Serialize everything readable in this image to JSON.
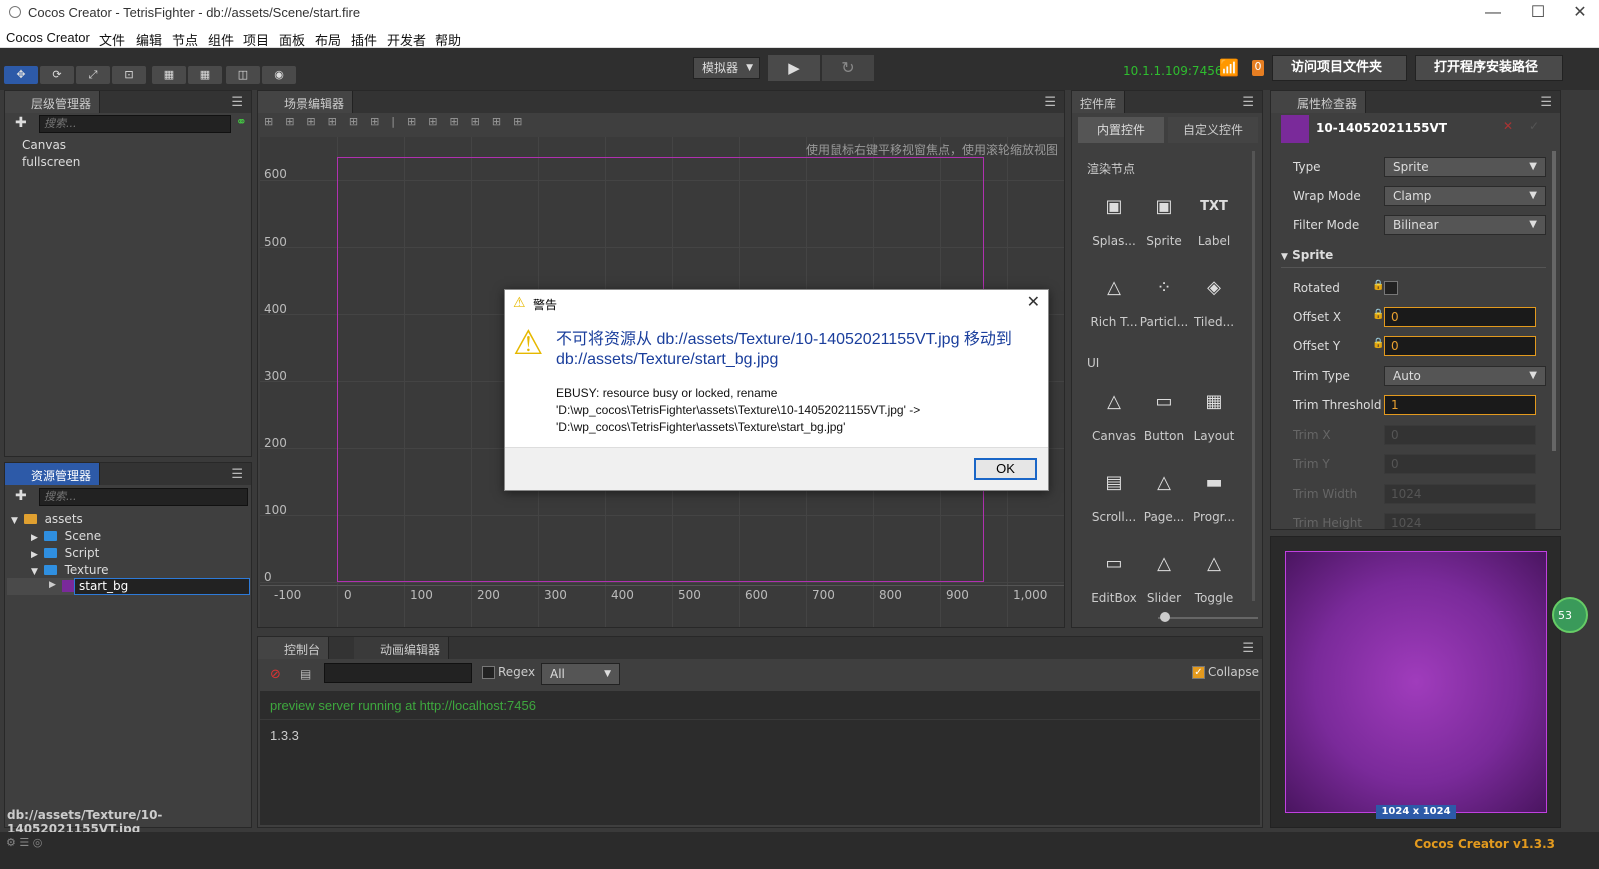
{
  "window": {
    "title": "Cocos Creator - TetrisFighter - db://assets/Scene/start.fire",
    "minimize": "—",
    "maximize": "☐",
    "close": "✕"
  },
  "menu": [
    "Cocos Creator",
    "文件",
    "编辑",
    "节点",
    "组件",
    "项目",
    "面板",
    "布局",
    "插件",
    "开发者",
    "帮助"
  ],
  "toolbar": {
    "platform_select": "模拟器",
    "play_icon": "▶",
    "refresh_icon": "↻",
    "ip": "10.1.1.109:7456",
    "badge": "0",
    "open_project_btn": "访问项目文件夹",
    "open_install_btn": "打开程序安装路径"
  },
  "hierarchy": {
    "title": "层级管理器",
    "search_placeholder": "搜索...",
    "items": [
      "Canvas",
      "fullscreen"
    ]
  },
  "assets": {
    "title": "资源管理器",
    "search_placeholder": "搜索...",
    "root": "assets",
    "children": [
      "Scene",
      "Script",
      "Texture"
    ],
    "editing_name": "start_bg",
    "status_path": "db://assets/Texture/10-14052021155VT.jpg"
  },
  "scene": {
    "title": "场景编辑器",
    "hint": "使用鼠标右键平移视窗焦点，使用滚轮缩放视图",
    "y_ticks": [
      "600",
      "500",
      "400",
      "300",
      "200",
      "100",
      "0"
    ],
    "x_ticks": [
      "-100",
      "0",
      "100",
      "200",
      "300",
      "400",
      "500",
      "600",
      "700",
      "800",
      "900",
      "1,000"
    ]
  },
  "components": {
    "title": "控件库",
    "tab_builtin": "内置控件",
    "tab_custom": "自定义控件",
    "section_render": "渲染节点",
    "section_ui": "UI",
    "render_items": [
      "Splas...",
      "Sprite",
      "Label",
      "Rich T...",
      "Particl...",
      "Tiled..."
    ],
    "ui_items": [
      "Canvas",
      "Button",
      "Layout",
      "Scroll...",
      "Page...",
      "Progr...",
      "EditBox",
      "Slider",
      "Toggle"
    ]
  },
  "inspector": {
    "title": "属性检查器",
    "asset_name": "10-14052021155VT",
    "type_label": "Type",
    "type_value": "Sprite",
    "wrap_label": "Wrap Mode",
    "wrap_value": "Clamp",
    "filter_label": "Filter Mode",
    "filter_value": "Bilinear",
    "sprite_section": "Sprite",
    "rotated_label": "Rotated",
    "offset_x_label": "Offset X",
    "offset_x_value": "0",
    "offset_y_label": "Offset Y",
    "offset_y_value": "0",
    "trim_type_label": "Trim Type",
    "trim_type_value": "Auto",
    "trim_threshold_label": "Trim Threshold",
    "trim_threshold_value": "1",
    "trim_x_label": "Trim X",
    "trim_x_value": "0",
    "trim_y_label": "Trim Y",
    "trim_y_value": "0",
    "trim_width_label": "Trim Width",
    "trim_width_value": "1024",
    "trim_height_label": "Trim Height",
    "trim_height_value": "1024",
    "preview_size": "1024 x 1024",
    "side_badge": "53"
  },
  "console": {
    "tab_console": "控制台",
    "tab_anim": "动画编辑器",
    "regex_label": "Regex",
    "filter_value": "All",
    "collapse_label": "Collapse",
    "lines": [
      "preview server running at http://localhost:7456",
      "1.3.3"
    ],
    "line_color": "#3ea83e"
  },
  "dialog": {
    "title": "警告",
    "message": "不可将资源从 db://assets/Texture/10-14052021155VT.jpg 移动到 db://assets/Texture/start_bg.jpg",
    "detail_1": "EBUSY: resource busy or locked, rename",
    "detail_2": "'D:\\wp_cocos\\TetrisFighter\\assets\\Texture\\10-14052021155VT.jpg' ->",
    "detail_3": "'D:\\wp_cocos\\TetrisFighter\\assets\\Texture\\start_bg.jpg'",
    "ok_label": "OK"
  },
  "footer": {
    "version": "Cocos Creator v1.3.3"
  }
}
